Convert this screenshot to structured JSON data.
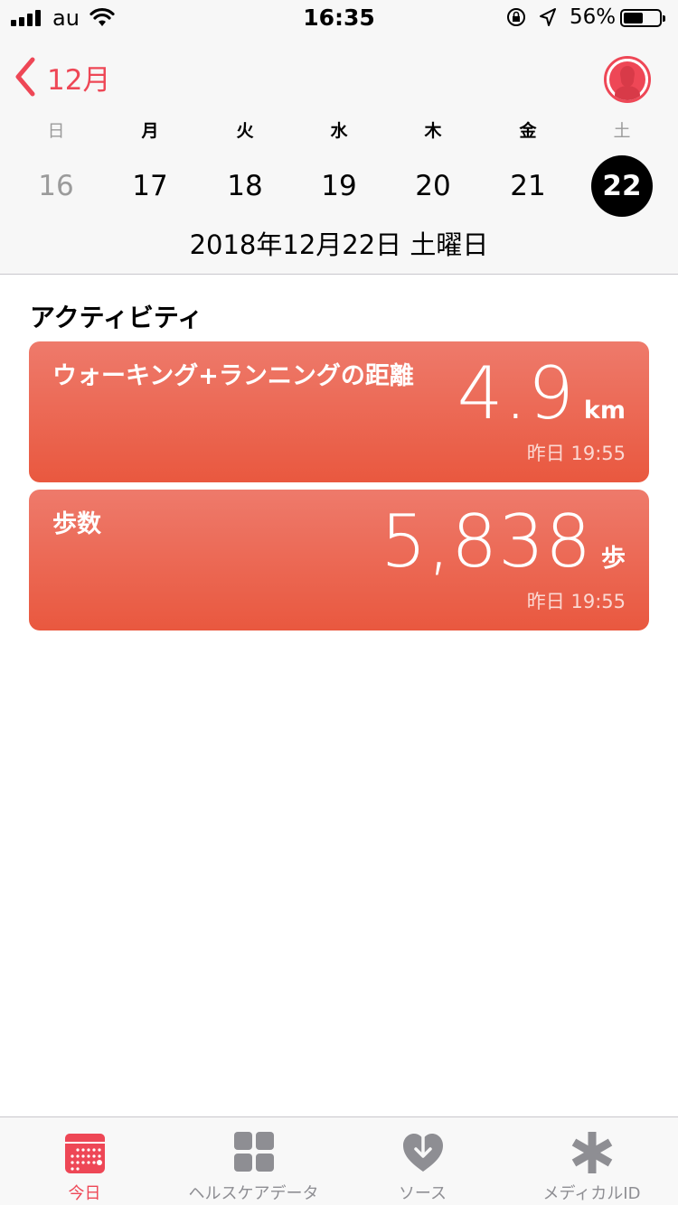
{
  "status_bar": {
    "carrier": "au",
    "time": "16:35",
    "battery_percent": "56%",
    "battery_level": 0.56
  },
  "header": {
    "back_label": "12月",
    "week_day_names": [
      "日",
      "月",
      "火",
      "水",
      "木",
      "金",
      "土"
    ],
    "week_dates": [
      "16",
      "17",
      "18",
      "19",
      "20",
      "21",
      "22"
    ],
    "selected_date": "22",
    "full_date": "2018年12月22日 土曜日"
  },
  "activity": {
    "section_title": "アクティビティ",
    "cards": [
      {
        "title": "ウォーキング+ランニングの距離",
        "value": "4.9",
        "unit": "km",
        "time": "昨日 19:55"
      },
      {
        "title": "歩数",
        "value": "5,838",
        "unit": "歩",
        "time": "昨日 19:55"
      }
    ]
  },
  "tab_bar": {
    "tabs": [
      {
        "label": "今日",
        "icon": "calendar-icon",
        "active": true
      },
      {
        "label": "ヘルスケアデータ",
        "icon": "grid-icon",
        "active": false
      },
      {
        "label": "ソース",
        "icon": "heart-download-icon",
        "active": false
      },
      {
        "label": "メディカルID",
        "icon": "asterisk-icon",
        "active": false
      }
    ]
  },
  "colors": {
    "accent": "#ee4756",
    "card_top": "#ee7a6b",
    "card_bottom": "#e9583f",
    "inactive": "#8e8e93"
  }
}
